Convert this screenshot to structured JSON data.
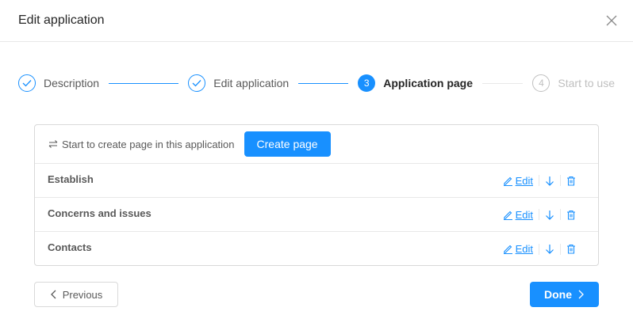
{
  "dialog": {
    "title": "Edit application"
  },
  "steps": [
    {
      "label": "Description",
      "status": "finished",
      "number": "1"
    },
    {
      "label": "Edit application",
      "status": "finished",
      "number": "2"
    },
    {
      "label": "Application page",
      "status": "active",
      "number": "3"
    },
    {
      "label": "Start to use",
      "status": "waiting",
      "number": "4"
    }
  ],
  "panel": {
    "hint": "Start to create page in this application",
    "create_label": "Create page",
    "pages": [
      {
        "name": "Establish",
        "edit_label": "Edit"
      },
      {
        "name": "Concerns and issues",
        "edit_label": "Edit"
      },
      {
        "name": "Contacts",
        "edit_label": "Edit"
      }
    ]
  },
  "footer": {
    "previous_label": "Previous",
    "done_label": "Done"
  },
  "colors": {
    "accent": "#1890ff",
    "border": "#d9d9d9",
    "muted": "#bfbfbf"
  },
  "icons": [
    "close-icon",
    "check-icon",
    "swap-icon",
    "edit-icon",
    "arrow-down-icon",
    "delete-icon",
    "chevron-left-icon",
    "chevron-right-icon"
  ]
}
